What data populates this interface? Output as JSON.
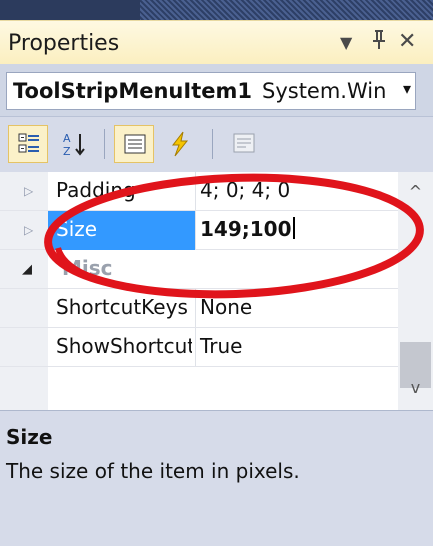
{
  "panel": {
    "title": "Properties",
    "dropdown_icon": "dropdown-arrow-icon",
    "pin_icon": "pin-icon",
    "close_icon": "close-icon",
    "controls": {
      "dropdown": "▼",
      "pin": "ᚁ",
      "close": "✕"
    }
  },
  "object_selector": {
    "name": "ToolStripMenuItem1",
    "type": "System.Win",
    "arrow": "▾"
  },
  "toolbar": {
    "buttons": [
      {
        "name": "categorized-icon",
        "active": true
      },
      {
        "name": "alphabetical-icon",
        "active": false
      },
      {
        "name": "properties-icon",
        "active": true
      },
      {
        "name": "events-icon",
        "active": false
      },
      {
        "name": "property-pages-icon",
        "active": false
      }
    ]
  },
  "grid": {
    "rows": [
      {
        "name": "Padding",
        "value": "4; 0; 4; 0",
        "type": "property",
        "expander": "▷"
      },
      {
        "name": "Size",
        "value": "149;100",
        "type": "property",
        "expander": "▷",
        "selected": true
      },
      {
        "name": "Misc",
        "value": "",
        "type": "category",
        "expander": "◢"
      },
      {
        "name": "ShortcutKeys",
        "value": "None",
        "type": "property"
      },
      {
        "name": "ShowShortcutKeys",
        "value": "True",
        "type": "property"
      }
    ],
    "scroll": {
      "up": "^",
      "down": "v",
      "thumb_position_fraction": 0.78
    }
  },
  "description": {
    "title": "Size",
    "text": "The size of the item in pixels."
  },
  "colors": {
    "selection": "#3399ff",
    "annotation_ellipse": "#e0141b",
    "title_bar": "#fbefc0"
  }
}
